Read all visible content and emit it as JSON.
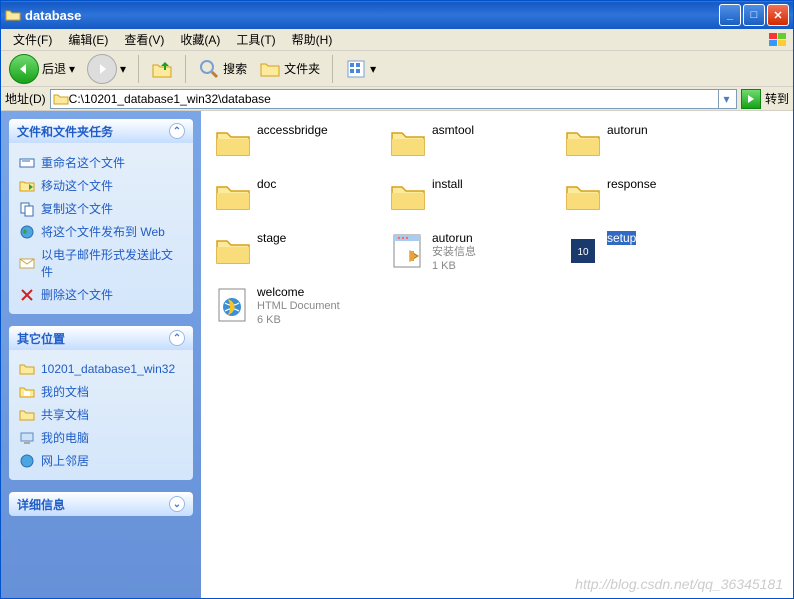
{
  "window": {
    "title": "database"
  },
  "menu": {
    "file": "文件(F)",
    "edit": "编辑(E)",
    "view": "查看(V)",
    "favorites": "收藏(A)",
    "tools": "工具(T)",
    "help": "帮助(H)"
  },
  "toolbar": {
    "back": "后退",
    "search": "搜索",
    "folders": "文件夹"
  },
  "address": {
    "label": "地址(D)",
    "path": "C:\\10201_database1_win32\\database",
    "go": "转到"
  },
  "panels": {
    "tasks": {
      "title": "文件和文件夹任务",
      "items": [
        "重命名这个文件",
        "移动这个文件",
        "复制这个文件",
        "将这个文件发布到 Web",
        "以电子邮件形式发送此文件",
        "删除这个文件"
      ]
    },
    "places": {
      "title": "其它位置",
      "items": [
        "10201_database1_win32",
        "我的文档",
        "共享文档",
        "我的电脑",
        "网上邻居"
      ]
    },
    "details": {
      "title": "详细信息"
    }
  },
  "files": [
    {
      "name": "accessbridge",
      "type": "folder"
    },
    {
      "name": "asmtool",
      "type": "folder"
    },
    {
      "name": "autorun",
      "type": "folder"
    },
    {
      "name": "doc",
      "type": "folder"
    },
    {
      "name": "install",
      "type": "folder"
    },
    {
      "name": "response",
      "type": "folder"
    },
    {
      "name": "stage",
      "type": "folder"
    },
    {
      "name": "autorun",
      "type": "inf",
      "sub": "安装信息",
      "size": "1 KB"
    },
    {
      "name": "setup",
      "type": "exe",
      "selected": true
    },
    {
      "name": "welcome",
      "type": "html",
      "sub": "HTML Document",
      "size": "6 KB"
    }
  ],
  "watermark": "http://blog.csdn.net/qq_36345181"
}
